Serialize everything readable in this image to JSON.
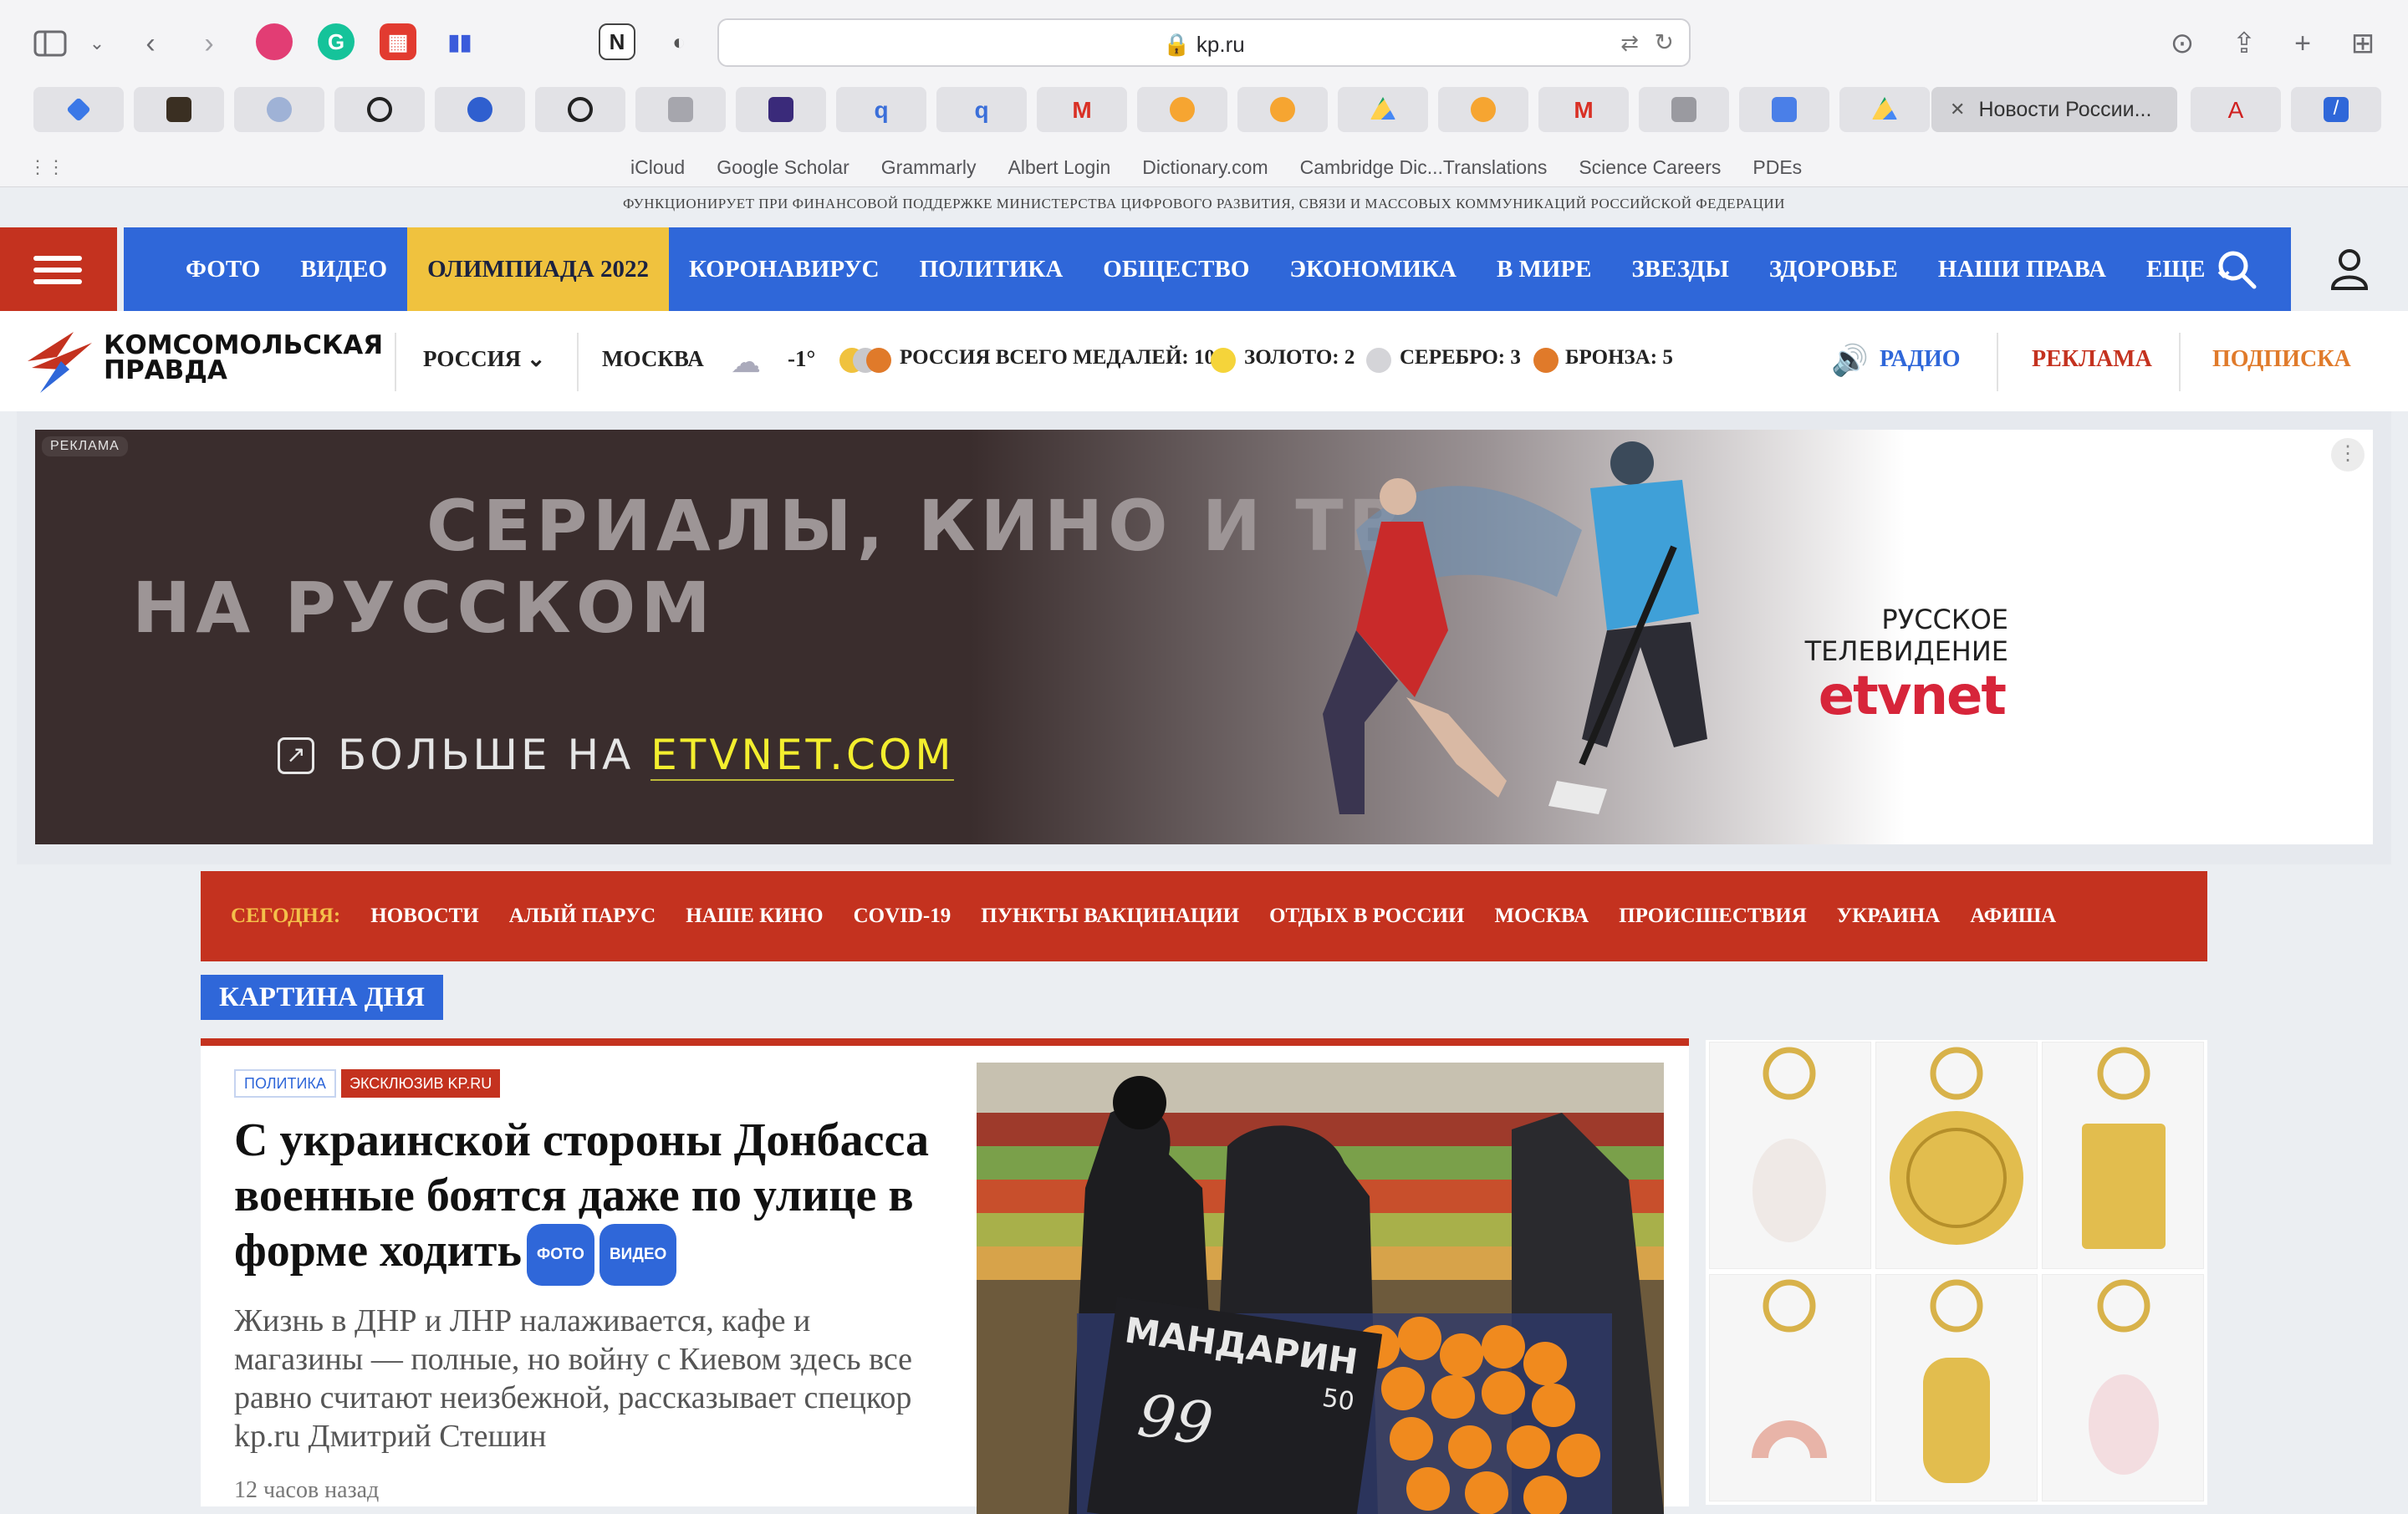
{
  "browser": {
    "url": "kp.ru",
    "active_tab_title": "Новости России...",
    "bookmarks": [
      "iCloud",
      "Google Scholar",
      "Grammarly",
      "Albert Login",
      "Dictionary.com",
      "Cambridge Dic...Translations",
      "Science Careers",
      "PDEs"
    ]
  },
  "site": {
    "notice": "ФУНКЦИОНИРУЕТ ПРИ ФИНАНСОВОЙ ПОДДЕРЖКЕ МИНИСТЕРСТВА ЦИФРОВОГО РАЗВИТИЯ, СВЯЗИ И МАССОВЫХ КОММУНИКАЦИЙ РОССИЙСКОЙ ФЕДЕРАЦИИ",
    "nav": [
      "ФОТО",
      "ВИДЕО",
      "ОЛИМПИАДА 2022",
      "КОРОНАВИРУС",
      "ПОЛИТИКА",
      "ОБЩЕСТВО",
      "ЭКОНОМИКА",
      "В МИРЕ",
      "ЗВЕЗДЫ",
      "ЗДОРОВЬЕ",
      "НАШИ ПРАВА",
      "ЕЩЕ"
    ],
    "logo_line1": "КОМСОМОЛЬСКАЯ",
    "logo_line2": "ПРАВДА",
    "region": "РОССИЯ",
    "city": "МОСКВА",
    "temperature": "-1°",
    "medals_total": "РОССИЯ ВСЕГО МЕДАЛЕЙ: 10",
    "gold": "ЗОЛОТО: 2",
    "silver": "СЕРЕБРО: 3",
    "bronze": "БРОНЗА: 5",
    "radio": "РАДИО",
    "ads_link": "РЕКЛАМА",
    "subscribe": "ПОДПИСКА",
    "colors": {
      "accent_red": "#c4321f",
      "nav_blue": "#2f67d9",
      "olympic_yellow": "#f0c23e",
      "subscribe_orange": "#e07a2a"
    }
  },
  "ad": {
    "tag": "РЕКЛАМА",
    "line1": "СЕРИАЛЫ, КИНО И ТВ",
    "line2": "НА РУССКОМ",
    "cta_prefix": "БОЛЬШЕ НА ",
    "cta_link": "ETVNET.COM",
    "brand_line1": "РУССКОЕ",
    "brand_line2": "ТЕЛЕВИДЕНИЕ",
    "brand_logo": "etvnet"
  },
  "today": {
    "label": "СЕГОДНЯ:",
    "items": [
      "НОВОСТИ",
      "АЛЫЙ ПАРУС",
      "НАШЕ КИНО",
      "COVID-19",
      "ПУНКТЫ ВАКЦИНАЦИИ",
      "ОТДЫХ В РОССИИ",
      "МОСКВА",
      "ПРОИСШЕСТВИЯ",
      "УКРАИНА",
      "АФИША"
    ]
  },
  "section_title": "КАРТИНА ДНЯ",
  "article": {
    "tag1": "ПОЛИТИКА",
    "tag2": "ЭКСКЛЮЗИВ KP.RU",
    "headline": "С украинской стороны Донбасса военные боятся даже по улице в форме ходить",
    "pill_photo": "ФОТО",
    "pill_video": "ВИДЕО",
    "lead": "Жизнь в ДНР и ЛНР налаживается, кафе и магазины — полные, но войну с Киевом здесь все равно считают неизбежной, рассказывает спецкор kp.ru Дмитрий Стешин",
    "time": "12 часов назад",
    "photo_sign_word": "МАНДАРИН",
    "photo_sign_num": "50",
    "photo_sign_price": "99"
  }
}
